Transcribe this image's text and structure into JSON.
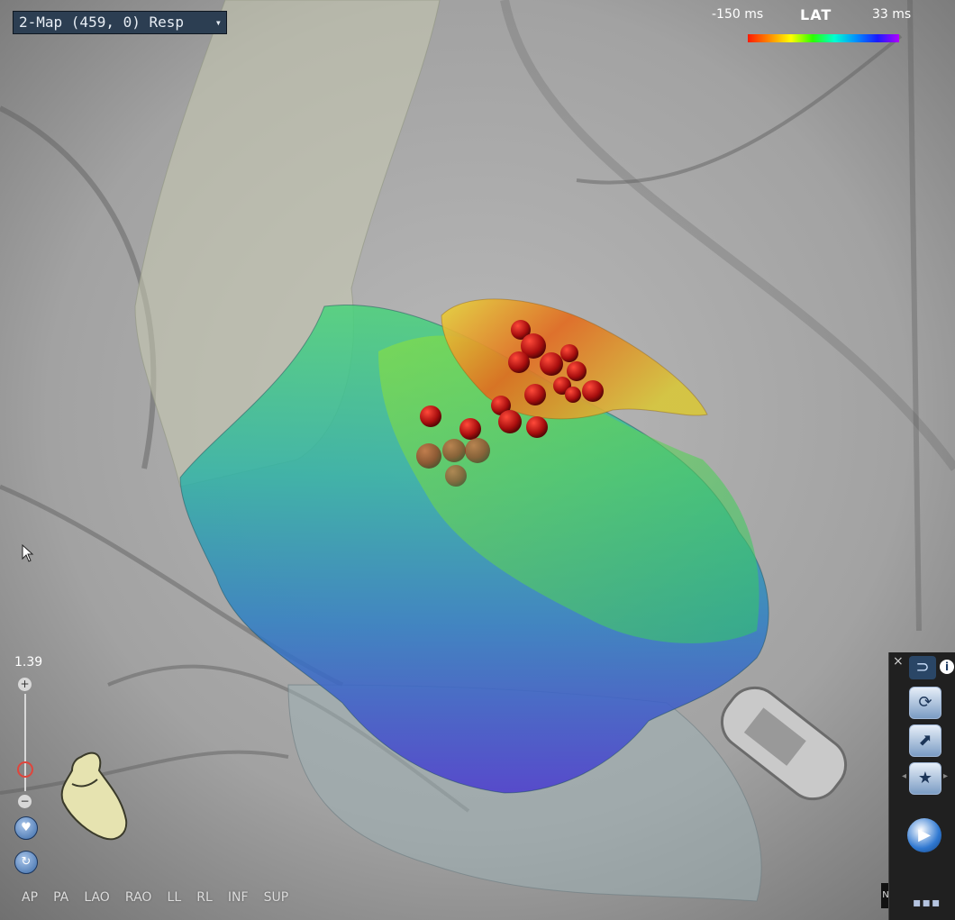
{
  "map_selector": {
    "label": "2-Map (459, 0) Resp",
    "chevron": "▾"
  },
  "legend": {
    "min_label": "-150 ms",
    "title": "LAT",
    "max_label": "33 ms",
    "colors": [
      "#ff1a00",
      "#ff8a00",
      "#ffff00",
      "#2cff00",
      "#00ffd0",
      "#0090ff",
      "#1a1aff",
      "#b000ff"
    ]
  },
  "zoom": {
    "value": "1.39",
    "plus": "+",
    "minus": "−"
  },
  "nav": {
    "heart_icon": "heart-icon",
    "reset_icon": "rotate-icon"
  },
  "view_buttons": [
    "AP",
    "PA",
    "LAO",
    "RAO",
    "LL",
    "RL",
    "INF",
    "SUP"
  ],
  "tool_panel": {
    "close": "×",
    "menu_icon": "catheter-icon",
    "info": "i",
    "tools": [
      {
        "icon": "rotate-view-icon",
        "glyph": "⟳"
      },
      {
        "icon": "tag-icon",
        "glyph": "⬈"
      },
      {
        "icon": "star-icon",
        "glyph": "★"
      }
    ],
    "play": "▶",
    "more": "▪▪▪"
  },
  "side_tab": "N",
  "colors": {
    "toolbar_bg": "#2c3e52",
    "panel_bg": "#202020",
    "ablation_point": "#b01010"
  }
}
